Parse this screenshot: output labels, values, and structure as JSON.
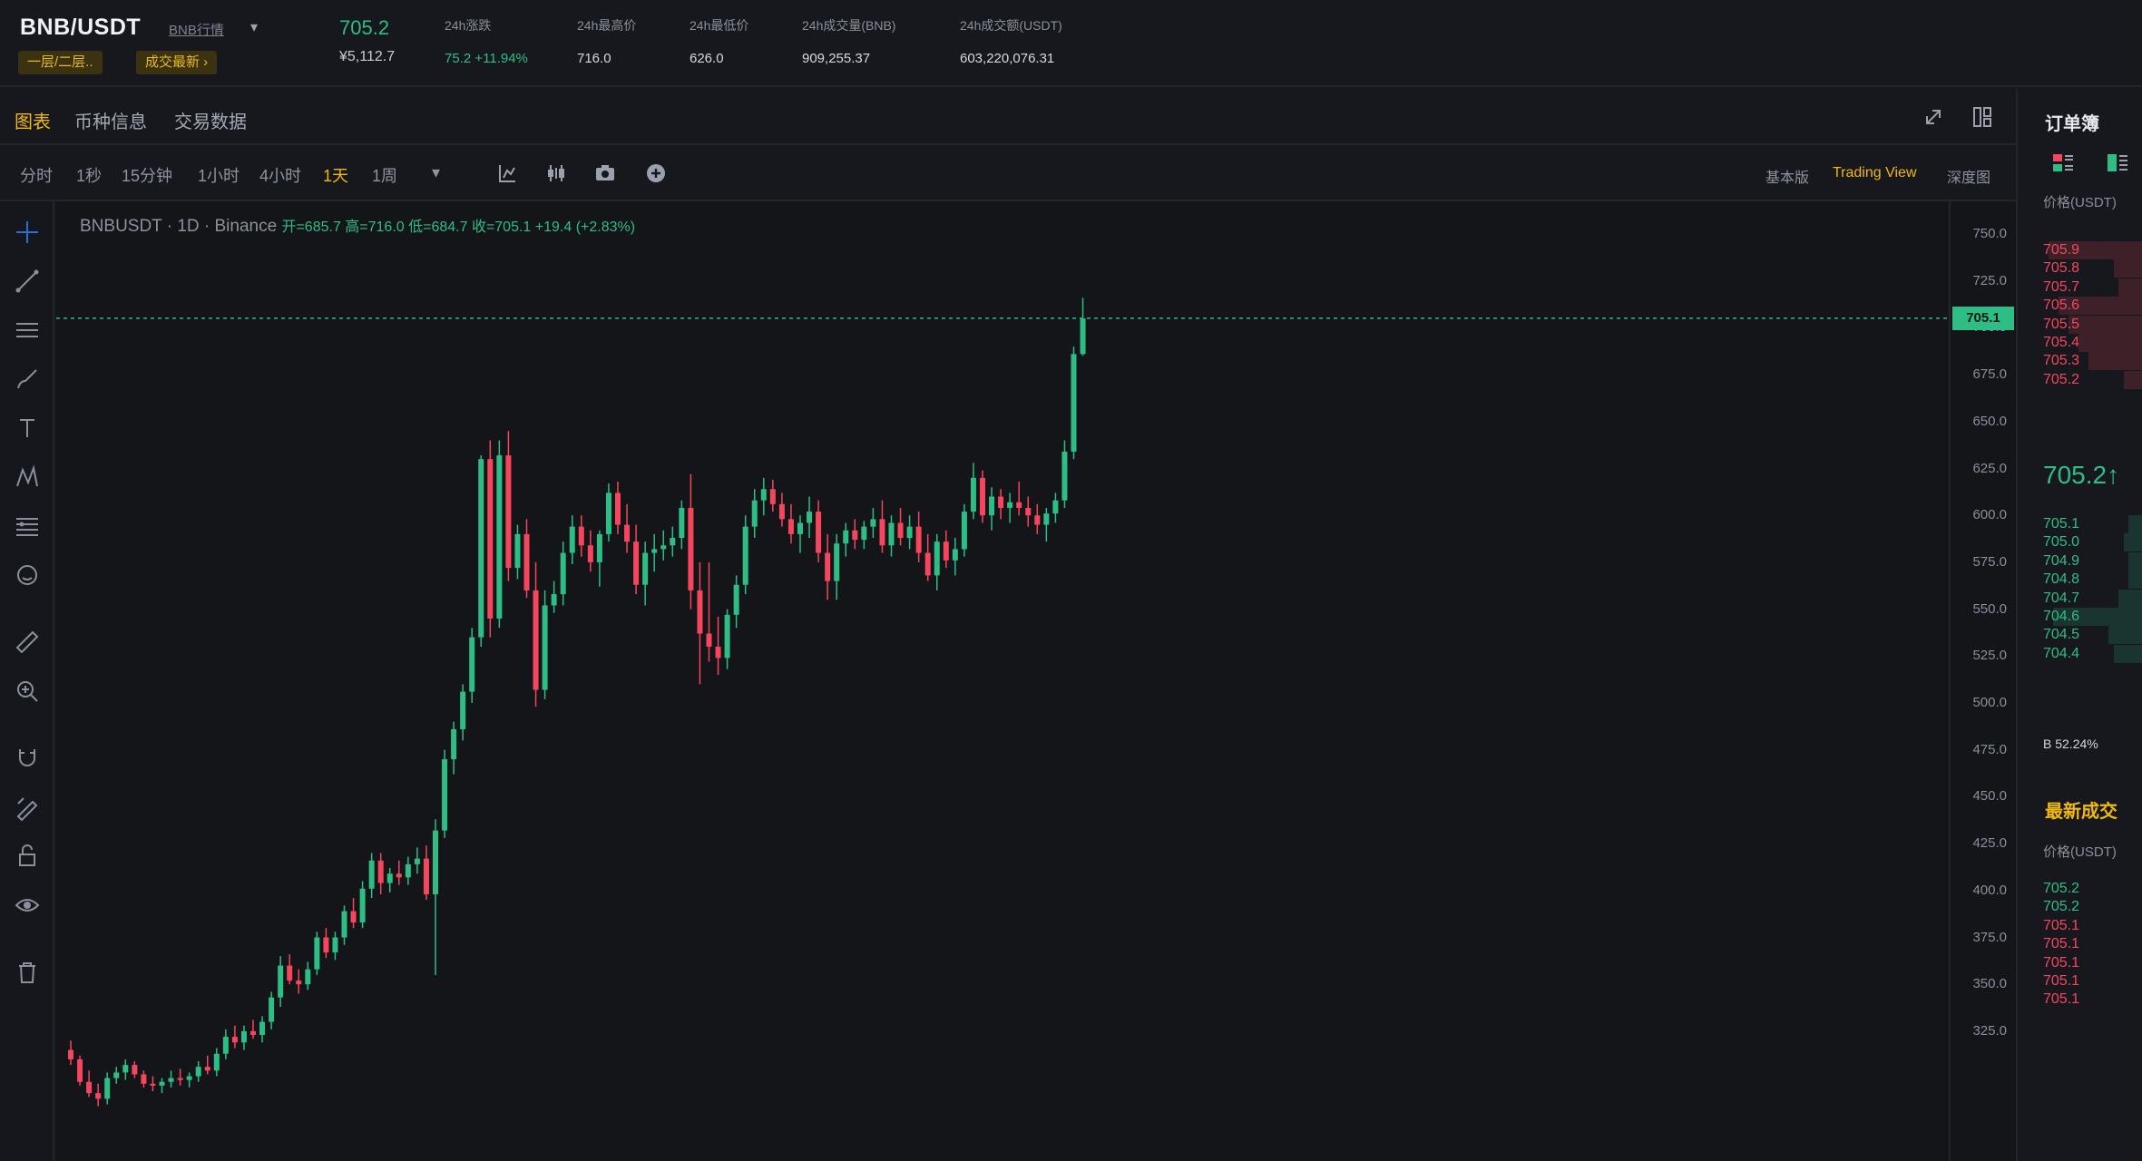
{
  "header": {
    "pair": "BNB/USDT",
    "pair_link": "BNB行情",
    "zone_tag": "一层/二层..",
    "news_tag": "成交最新 ›",
    "last_price": "705.2",
    "last_price_fiat": "¥5,112.7",
    "stats": [
      {
        "label": "24h涨跌",
        "value": "75.2 +11.94%",
        "positive": true
      },
      {
        "label": "24h最高价",
        "value": "716.0"
      },
      {
        "label": "24h最低价",
        "value": "626.0"
      },
      {
        "label": "24h成交量(BNB)",
        "value": "909,255.37"
      },
      {
        "label": "24h成交额(USDT)",
        "value": "603,220,076.31"
      }
    ]
  },
  "tabs": [
    {
      "label": "图表",
      "active": true
    },
    {
      "label": "币种信息",
      "active": false
    },
    {
      "label": "交易数据",
      "active": false
    }
  ],
  "timeframes": [
    {
      "label": "分时",
      "active": false
    },
    {
      "label": "1秒",
      "active": false
    },
    {
      "label": "15分钟",
      "active": false
    },
    {
      "label": "1小时",
      "active": false
    },
    {
      "label": "4小时",
      "active": false
    },
    {
      "label": "1天",
      "active": true
    },
    {
      "label": "1周",
      "active": false
    }
  ],
  "view_options": [
    {
      "label": "基本版",
      "active": false
    },
    {
      "label": "Trading View",
      "active": true
    },
    {
      "label": "深度图",
      "active": false
    }
  ],
  "legend": {
    "symbol": "BNBUSDT · 1D · Binance",
    "ohlc": "开=685.7 高=716.0 低=684.7 收=705.1 +19.4 (+2.83%)"
  },
  "chart_data": {
    "type": "candlestick",
    "symbol": "BNBUSDT",
    "interval": "1D",
    "ylim": [
      300,
      760
    ],
    "y_ticks": [
      "750.0",
      "725.0",
      "700.0",
      "675.0",
      "650.0",
      "625.0",
      "600.0",
      "575.0",
      "550.0",
      "525.0",
      "500.0",
      "475.0",
      "450.0",
      "425.0",
      "400.0",
      "375.0",
      "350.0",
      "325.0"
    ],
    "current_price_label": "705.1",
    "current_price": 705.1,
    "colors": {
      "up": "#2ebd85",
      "down": "#f6465d"
    },
    "candles": [
      [
        315,
        320,
        307,
        310
      ],
      [
        310,
        312,
        296,
        298
      ],
      [
        298,
        304,
        290,
        292
      ],
      [
        292,
        297,
        285,
        289
      ],
      [
        289,
        303,
        286,
        300
      ],
      [
        300,
        306,
        297,
        303
      ],
      [
        303,
        310,
        299,
        307
      ],
      [
        307,
        309,
        300,
        302
      ],
      [
        302,
        304,
        295,
        297
      ],
      [
        297,
        301,
        293,
        296
      ],
      [
        296,
        300,
        292,
        298
      ],
      [
        298,
        304,
        295,
        300
      ],
      [
        300,
        305,
        296,
        299
      ],
      [
        299,
        303,
        295,
        301
      ],
      [
        301,
        309,
        298,
        306
      ],
      [
        306,
        312,
        302,
        304
      ],
      [
        304,
        316,
        301,
        313
      ],
      [
        313,
        326,
        310,
        322
      ],
      [
        322,
        328,
        316,
        319
      ],
      [
        319,
        328,
        315,
        325
      ],
      [
        325,
        331,
        321,
        323
      ],
      [
        323,
        333,
        319,
        330
      ],
      [
        330,
        346,
        326,
        343
      ],
      [
        343,
        365,
        338,
        360
      ],
      [
        360,
        366,
        350,
        352
      ],
      [
        352,
        358,
        345,
        350
      ],
      [
        350,
        362,
        347,
        358
      ],
      [
        358,
        378,
        355,
        375
      ],
      [
        375,
        380,
        364,
        367
      ],
      [
        367,
        378,
        363,
        375
      ],
      [
        375,
        392,
        371,
        389
      ],
      [
        389,
        396,
        380,
        383
      ],
      [
        383,
        405,
        380,
        401
      ],
      [
        401,
        420,
        396,
        416
      ],
      [
        416,
        420,
        398,
        404
      ],
      [
        404,
        412,
        399,
        409
      ],
      [
        409,
        416,
        403,
        407
      ],
      [
        407,
        418,
        403,
        414
      ],
      [
        414,
        423,
        409,
        417
      ],
      [
        417,
        424,
        395,
        398
      ],
      [
        398,
        438,
        355,
        432
      ],
      [
        432,
        475,
        428,
        470
      ],
      [
        470,
        490,
        462,
        486
      ],
      [
        486,
        510,
        480,
        506
      ],
      [
        506,
        540,
        500,
        535
      ],
      [
        535,
        632,
        530,
        630
      ],
      [
        630,
        640,
        535,
        545
      ],
      [
        545,
        640,
        540,
        632
      ],
      [
        632,
        645,
        565,
        572
      ],
      [
        572,
        595,
        566,
        590
      ],
      [
        590,
        598,
        556,
        560
      ],
      [
        560,
        575,
        498,
        507
      ],
      [
        507,
        560,
        502,
        552
      ],
      [
        552,
        565,
        548,
        558
      ],
      [
        558,
        586,
        552,
        580
      ],
      [
        580,
        600,
        574,
        594
      ],
      [
        594,
        600,
        578,
        584
      ],
      [
        584,
        592,
        570,
        575
      ],
      [
        575,
        592,
        562,
        590
      ],
      [
        590,
        617,
        586,
        612
      ],
      [
        612,
        618,
        590,
        595
      ],
      [
        595,
        606,
        580,
        586
      ],
      [
        586,
        595,
        558,
        563
      ],
      [
        563,
        586,
        552,
        580
      ],
      [
        580,
        590,
        570,
        582
      ],
      [
        582,
        592,
        576,
        584
      ],
      [
        584,
        594,
        578,
        588
      ],
      [
        588,
        608,
        582,
        604
      ],
      [
        604,
        622,
        550,
        560
      ],
      [
        560,
        575,
        510,
        537
      ],
      [
        537,
        575,
        522,
        530
      ],
      [
        530,
        546,
        515,
        524
      ],
      [
        524,
        550,
        518,
        547
      ],
      [
        547,
        568,
        540,
        563
      ],
      [
        563,
        600,
        558,
        594
      ],
      [
        594,
        614,
        588,
        608
      ],
      [
        608,
        620,
        600,
        614
      ],
      [
        614,
        619,
        602,
        606
      ],
      [
        606,
        612,
        594,
        598
      ],
      [
        598,
        606,
        585,
        590
      ],
      [
        590,
        600,
        580,
        596
      ],
      [
        596,
        610,
        588,
        602
      ],
      [
        602,
        608,
        575,
        580
      ],
      [
        580,
        590,
        555,
        565
      ],
      [
        565,
        590,
        555,
        585
      ],
      [
        585,
        596,
        578,
        592
      ],
      [
        592,
        598,
        582,
        587
      ],
      [
        587,
        597,
        582,
        594
      ],
      [
        594,
        604,
        588,
        598
      ],
      [
        598,
        608,
        580,
        584
      ],
      [
        584,
        600,
        578,
        596
      ],
      [
        596,
        604,
        584,
        588
      ],
      [
        588,
        600,
        582,
        594
      ],
      [
        594,
        602,
        575,
        580
      ],
      [
        580,
        590,
        565,
        568
      ],
      [
        568,
        590,
        560,
        586
      ],
      [
        586,
        592,
        572,
        576
      ],
      [
        576,
        588,
        568,
        582
      ],
      [
        582,
        606,
        578,
        602
      ],
      [
        602,
        628,
        598,
        620
      ],
      [
        620,
        624,
        596,
        600
      ],
      [
        600,
        615,
        592,
        610
      ],
      [
        610,
        614,
        598,
        604
      ],
      [
        604,
        612,
        596,
        607
      ],
      [
        607,
        618,
        600,
        604
      ],
      [
        604,
        610,
        594,
        600
      ],
      [
        600,
        606,
        590,
        595
      ],
      [
        595,
        604,
        586,
        601
      ],
      [
        601,
        612,
        596,
        608
      ],
      [
        608,
        640,
        604,
        634
      ],
      [
        634,
        690,
        630,
        686
      ],
      [
        686,
        716,
        685,
        705
      ]
    ]
  },
  "order_book": {
    "title": "订单簿",
    "price_header": "价格(USDT)",
    "asks": [
      {
        "price": "705.9",
        "depth": 0.95
      },
      {
        "price": "705.8",
        "depth": 0.3
      },
      {
        "price": "705.7",
        "depth": 0.25
      },
      {
        "price": "705.6",
        "depth": 0.85
      },
      {
        "price": "705.5",
        "depth": 0.75
      },
      {
        "price": "705.4",
        "depth": 0.65
      },
      {
        "price": "705.3",
        "depth": 0.55
      },
      {
        "price": "705.2",
        "depth": 0.2
      }
    ],
    "mid_price": "705.2↑",
    "bids": [
      {
        "price": "705.1",
        "depth": 0.15
      },
      {
        "price": "705.0",
        "depth": 0.2
      },
      {
        "price": "704.9",
        "depth": 0.15
      },
      {
        "price": "704.8",
        "depth": 0.15
      },
      {
        "price": "704.7",
        "depth": 0.25
      },
      {
        "price": "704.6",
        "depth": 0.9
      },
      {
        "price": "704.5",
        "depth": 0.35
      },
      {
        "price": "704.4",
        "depth": 0.3
      }
    ],
    "ratio": "B  52.24%"
  },
  "trades": {
    "title": "最新成交",
    "price_header": "价格(USDT)",
    "rows": [
      {
        "price": "705.2",
        "side": "buy"
      },
      {
        "price": "705.2",
        "side": "buy"
      },
      {
        "price": "705.1",
        "side": "sell"
      },
      {
        "price": "705.1",
        "side": "sell"
      },
      {
        "price": "705.1",
        "side": "sell"
      },
      {
        "price": "705.1",
        "side": "sell"
      },
      {
        "price": "705.1",
        "side": "sell"
      }
    ]
  }
}
